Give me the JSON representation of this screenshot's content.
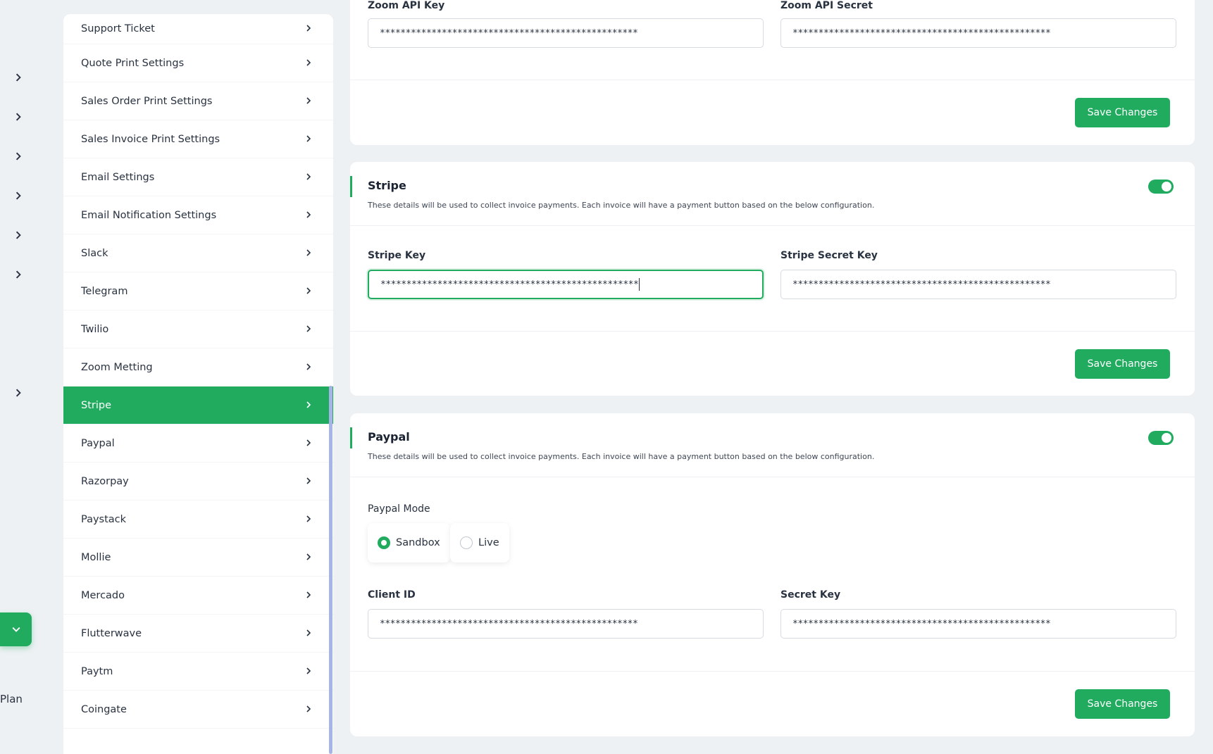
{
  "rail": {
    "plan_label": "Plan"
  },
  "menu": {
    "items": [
      {
        "label": "Support Ticket"
      },
      {
        "label": "Quote Print Settings"
      },
      {
        "label": "Sales Order Print Settings"
      },
      {
        "label": "Sales Invoice Print Settings"
      },
      {
        "label": "Email Settings"
      },
      {
        "label": "Email Notification Settings"
      },
      {
        "label": "Slack"
      },
      {
        "label": "Telegram"
      },
      {
        "label": "Twilio"
      },
      {
        "label": "Zoom Metting"
      },
      {
        "label": "Stripe"
      },
      {
        "label": "Paypal"
      },
      {
        "label": "Razorpay"
      },
      {
        "label": "Paystack"
      },
      {
        "label": "Mollie"
      },
      {
        "label": "Mercado"
      },
      {
        "label": "Flutterwave"
      },
      {
        "label": "Paytm"
      },
      {
        "label": "Coingate"
      }
    ],
    "active": "Stripe"
  },
  "zoom": {
    "api_key_label": "Zoom API Key",
    "api_key_value": "**************************************************",
    "api_secret_label": "Zoom API Secret",
    "api_secret_value": "**************************************************",
    "save_label": "Save Changes"
  },
  "stripe": {
    "title": "Stripe",
    "description": "These details will be used to collect invoice payments. Each invoice will have a payment button based on the below configuration.",
    "enabled": true,
    "key_label": "Stripe Key",
    "key_value": "**************************************************",
    "secret_label": "Stripe Secret Key",
    "secret_value": "**************************************************",
    "save_label": "Save Changes"
  },
  "paypal": {
    "title": "Paypal",
    "description": "These details will be used to collect invoice payments. Each invoice will have a payment button based on the below configuration.",
    "enabled": true,
    "mode_label": "Paypal Mode",
    "mode_options": [
      "Sandbox",
      "Live"
    ],
    "mode_selected": "Sandbox",
    "client_id_label": "Client ID",
    "client_id_value": "**************************************************",
    "secret_label": "Secret Key",
    "secret_value": "**************************************************",
    "save_label": "Save Changes"
  },
  "colors": {
    "accent": "#20ab5f",
    "scrollbar": "#a7b4e6"
  }
}
